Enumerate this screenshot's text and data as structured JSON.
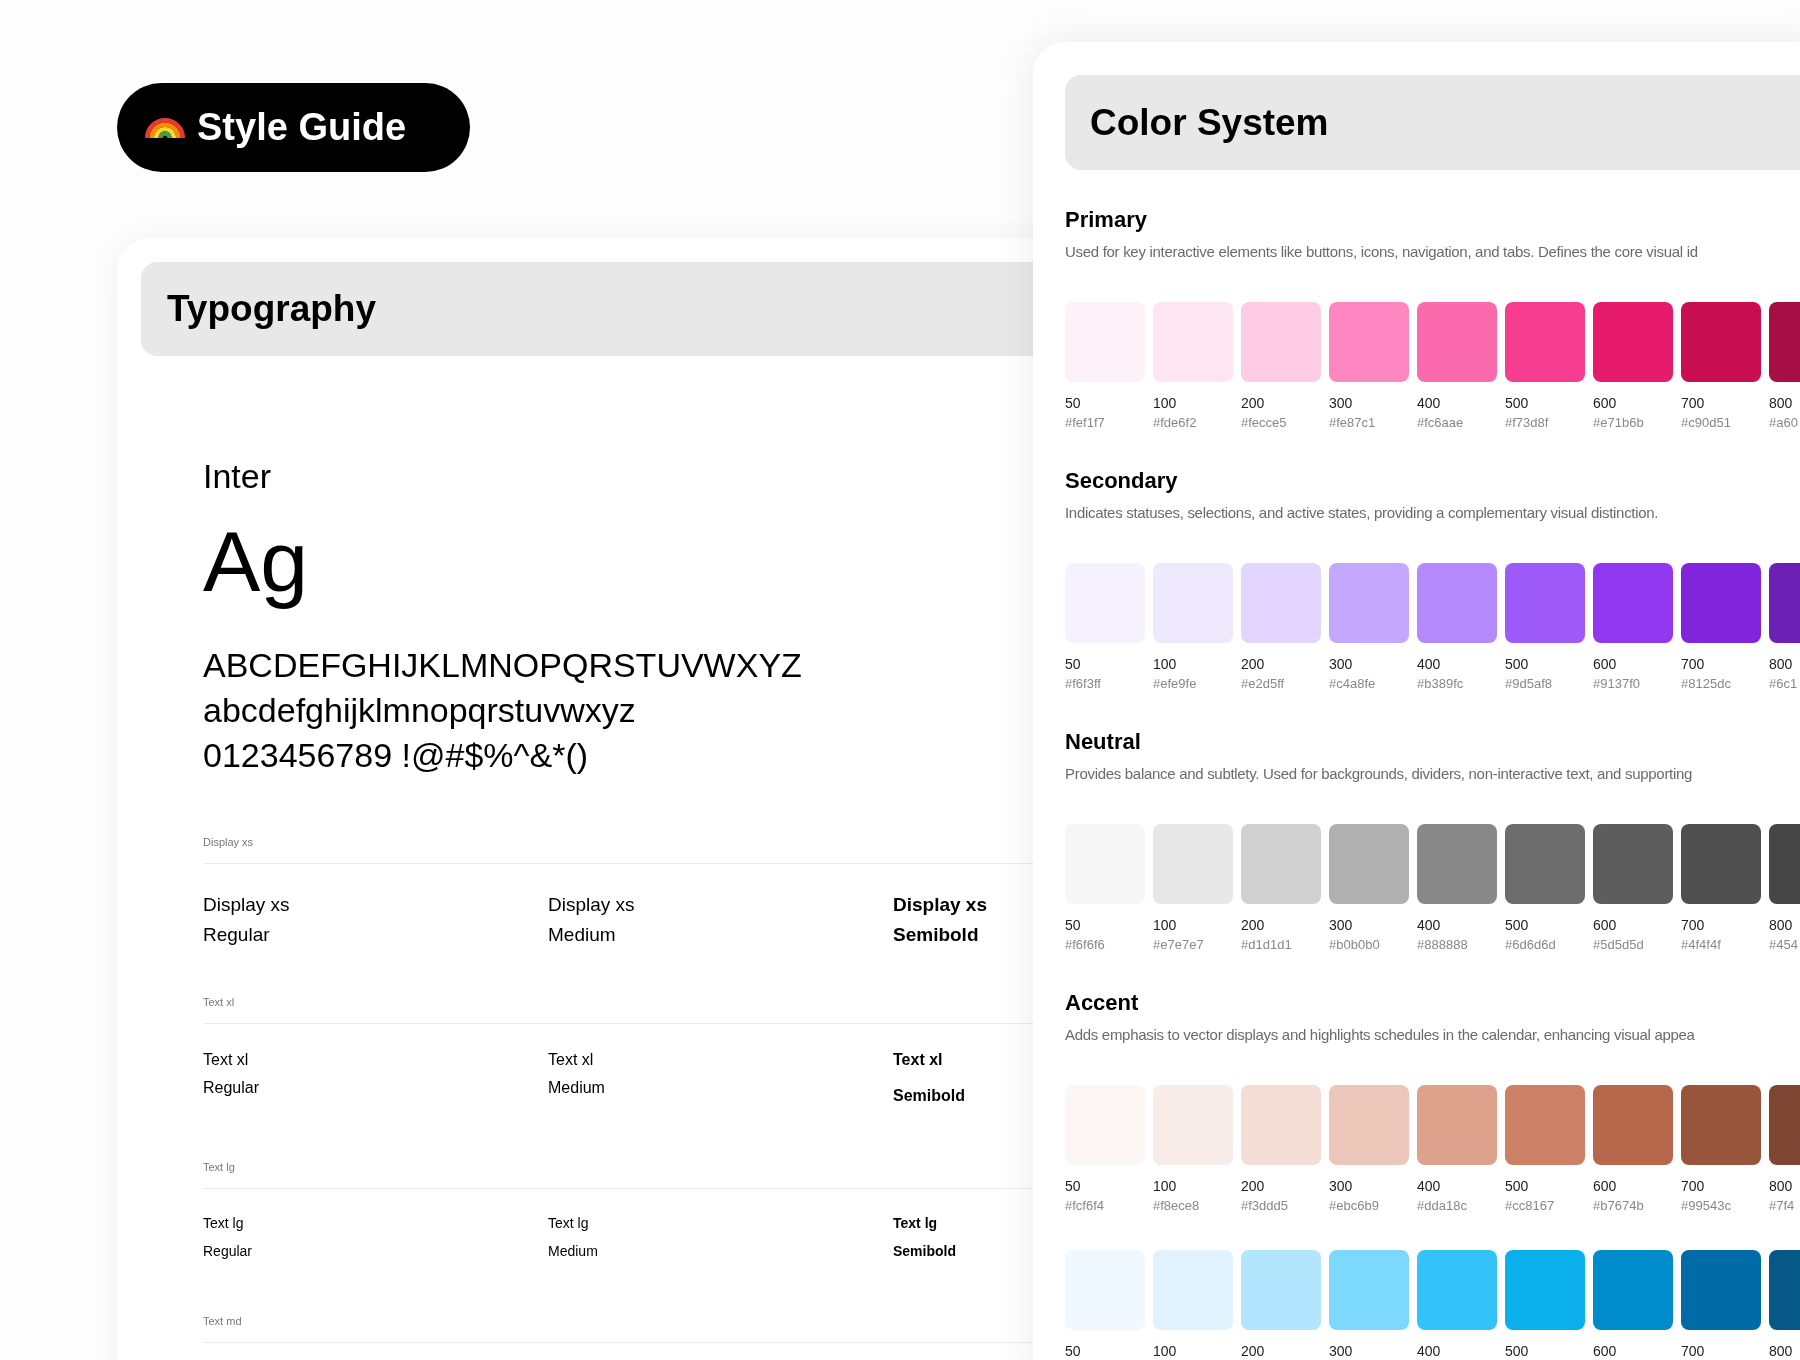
{
  "badge": {
    "title": "Style Guide"
  },
  "typography": {
    "title": "Typography",
    "font_name": "Inter",
    "specimen": "Ag",
    "charset": [
      "ABCDEFGHIJKLMNOPQRSTUVWXYZ",
      "abcdefghijklmnopqrstuvwxyz",
      "0123456789 !@#$%^&*()"
    ],
    "scales": [
      {
        "kind": "display-xs",
        "label": "Display xs",
        "samples": [
          {
            "kind": "regular",
            "name": "Display xs",
            "weight": "Regular"
          },
          {
            "kind": "medium",
            "name": "Display xs",
            "weight": "Medium"
          },
          {
            "kind": "semibold",
            "name": "Display xs",
            "weight": "Semibold"
          }
        ]
      },
      {
        "kind": "text-xl",
        "label": "Text xl",
        "samples": [
          {
            "kind": "regular",
            "name": "Text xl",
            "weight": "Regular"
          },
          {
            "kind": "medium",
            "name": "Text xl",
            "weight": "Medium"
          },
          {
            "kind": "semibold",
            "name": "Text xl",
            "weight": "Semibold"
          }
        ]
      },
      {
        "kind": "text-lg",
        "label": "Text lg",
        "samples": [
          {
            "kind": "regular",
            "name": "Text lg",
            "weight": "Regular"
          },
          {
            "kind": "medium",
            "name": "Text lg",
            "weight": "Medium"
          },
          {
            "kind": "semibold",
            "name": "Text lg",
            "weight": "Semibold"
          }
        ]
      },
      {
        "kind": "text-md",
        "label": "Text md"
      }
    ]
  },
  "color_system": {
    "title": "Color System",
    "sections": [
      {
        "title": "Primary",
        "description": "Used for key interactive elements like buttons, icons, navigation, and tabs. Defines the core visual id",
        "swatches": [
          {
            "step": "50",
            "hex": "#fef1f7",
            "color": "#fef1f7"
          },
          {
            "step": "100",
            "hex": "#fde6f2",
            "color": "#fde6f2"
          },
          {
            "step": "200",
            "hex": "#fecce5",
            "color": "#fecce5"
          },
          {
            "step": "300",
            "hex": "#fe87c1",
            "color": "#fe87c1"
          },
          {
            "step": "400",
            "hex": "#fc6aae",
            "color": "#fc6aae"
          },
          {
            "step": "500",
            "hex": "#f73d8f",
            "color": "#f73d8f"
          },
          {
            "step": "600",
            "hex": "#e71b6b",
            "color": "#e71b6b"
          },
          {
            "step": "700",
            "hex": "#c90d51",
            "color": "#c90d51"
          },
          {
            "step": "800",
            "hex": "#a60",
            "color": "#a60e44"
          }
        ]
      },
      {
        "title": "Secondary",
        "description": "Indicates statuses, selections, and active states, providing a complementary visual distinction.",
        "swatches": [
          {
            "step": "50",
            "hex": "#f6f3ff",
            "color": "#f6f3ff"
          },
          {
            "step": "100",
            "hex": "#efe9fe",
            "color": "#efe9fe"
          },
          {
            "step": "200",
            "hex": "#e2d5ff",
            "color": "#e2d5ff"
          },
          {
            "step": "300",
            "hex": "#c4a8fe",
            "color": "#c4a8fe"
          },
          {
            "step": "400",
            "hex": "#b389fc",
            "color": "#b389fc"
          },
          {
            "step": "500",
            "hex": "#9d5af8",
            "color": "#9d5af8"
          },
          {
            "step": "600",
            "hex": "#9137f0",
            "color": "#9137f0"
          },
          {
            "step": "700",
            "hex": "#8125dc",
            "color": "#8125dc"
          },
          {
            "step": "800",
            "hex": "#6c1",
            "color": "#6c1fb5"
          }
        ]
      },
      {
        "title": "Neutral",
        "description": "Provides balance and subtlety. Used for backgrounds, dividers, non-interactive text, and supporting",
        "swatches": [
          {
            "step": "50",
            "hex": "#f6f6f6",
            "color": "#f6f6f6"
          },
          {
            "step": "100",
            "hex": "#e7e7e7",
            "color": "#e7e7e7"
          },
          {
            "step": "200",
            "hex": "#d1d1d1",
            "color": "#d1d1d1"
          },
          {
            "step": "300",
            "hex": "#b0b0b0",
            "color": "#b0b0b0"
          },
          {
            "step": "400",
            "hex": "#888888",
            "color": "#888888"
          },
          {
            "step": "500",
            "hex": "#6d6d6d",
            "color": "#6d6d6d"
          },
          {
            "step": "600",
            "hex": "#5d5d5d",
            "color": "#5d5d5d"
          },
          {
            "step": "700",
            "hex": "#4f4f4f",
            "color": "#4f4f4f"
          },
          {
            "step": "800",
            "hex": "#454",
            "color": "#454545"
          }
        ]
      },
      {
        "title": "Accent",
        "description": "Adds emphasis to vector displays and highlights schedules in the calendar, enhancing visual appea",
        "swatches": [
          {
            "step": "50",
            "hex": "#fcf6f4",
            "color": "#fcf6f4"
          },
          {
            "step": "100",
            "hex": "#f8ece8",
            "color": "#f8ece8"
          },
          {
            "step": "200",
            "hex": "#f3ddd5",
            "color": "#f3ddd5"
          },
          {
            "step": "300",
            "hex": "#ebc6b9",
            "color": "#ebc6b9"
          },
          {
            "step": "400",
            "hex": "#dda18c",
            "color": "#dda18c"
          },
          {
            "step": "500",
            "hex": "#cc8167",
            "color": "#cc8167"
          },
          {
            "step": "600",
            "hex": "#b7674b",
            "color": "#b7674b"
          },
          {
            "step": "700",
            "hex": "#99543c",
            "color": "#99543c"
          },
          {
            "step": "800",
            "hex": "#7f4",
            "color": "#7f4533"
          }
        ]
      },
      {
        "swatches": [
          {
            "step": "50",
            "color": "#f0f9ff"
          },
          {
            "step": "100",
            "color": "#e0f2fe"
          },
          {
            "step": "200",
            "color": "#b3e6fe"
          },
          {
            "step": "300",
            "color": "#7cd8fd"
          },
          {
            "step": "400",
            "color": "#33c3fa"
          },
          {
            "step": "500",
            "color": "#0bafec"
          },
          {
            "step": "600",
            "color": "#008bcc"
          },
          {
            "step": "700",
            "color": "#006ba6"
          },
          {
            "step": "800",
            "color": "#065986"
          }
        ]
      }
    ]
  }
}
